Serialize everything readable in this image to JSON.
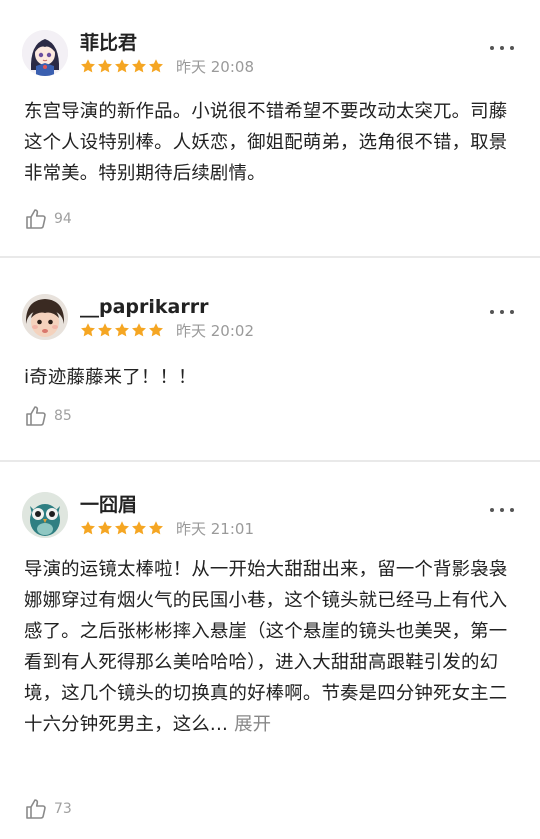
{
  "reviews": [
    {
      "name": "菲比君",
      "time": "昨天 20:08",
      "rating": 5,
      "content": "东宫导演的新作品。小说很不错希望不要改动太突兀。司藤这个人设特别棒。人妖恋，御姐配萌弟，选角很不错，取景非常美。特别期待后续剧情。",
      "likes": "94",
      "avatar_icon": "anime-girl-avatar"
    },
    {
      "name": "__paprikarrr",
      "time": "昨天 20:02",
      "rating": 5,
      "content": "i奇迹藤藤来了！！！",
      "likes": "85",
      "avatar_icon": "child-photo-avatar"
    },
    {
      "name": "一囧眉",
      "time": "昨天 21:01",
      "rating": 5,
      "content": "导演的运镜太棒啦！从一开始大甜甜出来，留一个背影袅袅娜娜穿过有烟火气的民国小巷，这个镜头就已经马上有代入感了。之后张彬彬摔入悬崖（这个悬崖的镜头也美哭，第一看到有人死得那么美哈哈哈），进入大甜甜高跟鞋引发的幻境，这几个镜头的切换真的好棒啊。节奏是四分钟死女主二十六分钟死男主，这么...",
      "expand_label": "展开",
      "likes": "73",
      "avatar_icon": "owl-avatar"
    }
  ],
  "colors": {
    "star": "#f5a623",
    "divider": "#e9e9e9",
    "meta_text": "#9a9a9a"
  }
}
